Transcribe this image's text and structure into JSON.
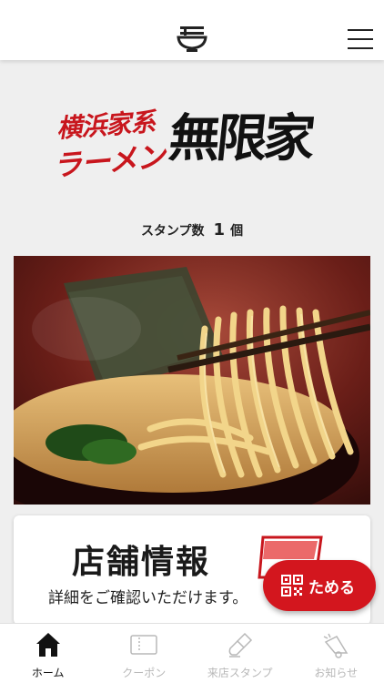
{
  "header": {
    "logo_icon": "ramen-bowl-icon",
    "menu_icon": "hamburger-menu-icon"
  },
  "brand": {
    "line1": "横浜家系",
    "line2": "ラーメン",
    "name": "無限家"
  },
  "stamps": {
    "label": "スタンプ数",
    "count": "1",
    "unit": "個"
  },
  "store_card": {
    "title": "店舗情報",
    "subtitle": "詳細をご確認いただけます。"
  },
  "save_button": {
    "label": "ためる",
    "icon": "qr-code-icon"
  },
  "tabs": [
    {
      "label": "ホーム",
      "icon": "home-icon",
      "active": true
    },
    {
      "label": "クーポン",
      "icon": "coupon-ticket-icon",
      "active": false
    },
    {
      "label": "来店スタンプ",
      "icon": "stamp-icon",
      "active": false
    },
    {
      "label": "お知らせ",
      "icon": "megaphone-icon",
      "active": false
    }
  ],
  "colors": {
    "accent": "#d3161e",
    "brand_red": "#c8161d",
    "background": "#efefef",
    "inactive_tab": "#b8b8b8"
  }
}
